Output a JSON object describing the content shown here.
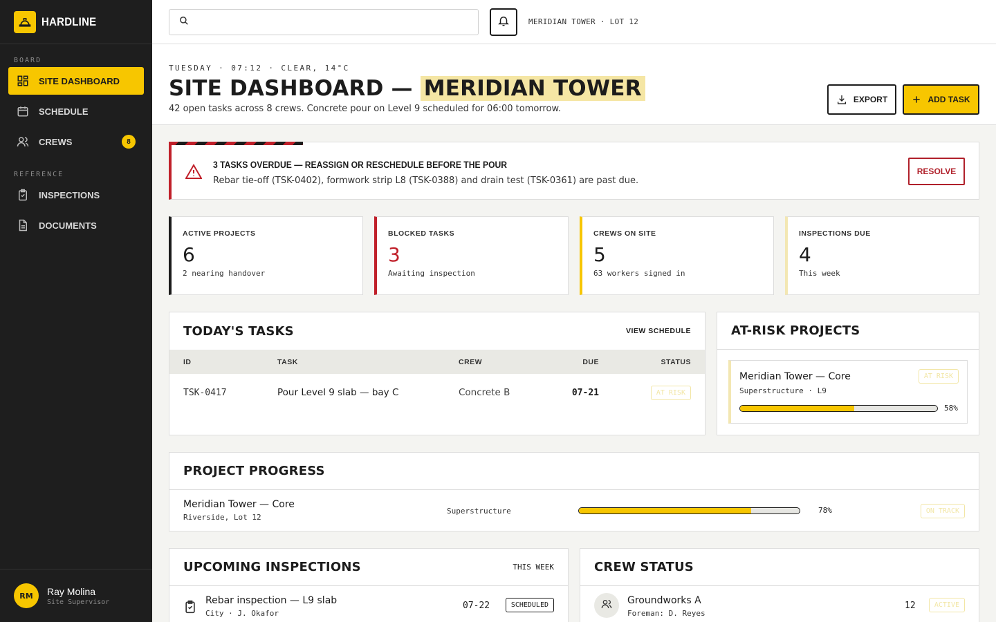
{
  "brand": {
    "name": "HARDLINE"
  },
  "sidebar": {
    "sections": [
      {
        "label": "BOARD",
        "items": [
          {
            "label": "SITE DASHBOARD",
            "icon": "grid-icon",
            "active": true
          },
          {
            "label": "SCHEDULE",
            "icon": "calendar-icon"
          },
          {
            "label": "CREWS",
            "icon": "users-icon",
            "badge": "8"
          }
        ]
      },
      {
        "label": "REFERENCE",
        "items": [
          {
            "label": "INSPECTIONS",
            "icon": "clipboard-check-icon"
          },
          {
            "label": "DOCUMENTS",
            "icon": "document-icon"
          }
        ]
      }
    ],
    "user": {
      "initials": "RM",
      "name": "Ray Molina",
      "role": "Site Supervisor"
    }
  },
  "topbar": {
    "search_placeholder": "",
    "site_label": "MERIDIAN TOWER · LOT 12"
  },
  "header": {
    "meta": "TUESDAY · 07:12 · CLEAR, 14°C",
    "title_prefix": "SITE DASHBOARD —",
    "title_highlight": "MERIDIAN TOWER",
    "subtitle": "42 open tasks across 8 crews. Concrete pour on Level 9 scheduled for 06:00 tomorrow.",
    "export_label": "EXPORT",
    "add_task_label": "ADD TASK"
  },
  "alert": {
    "title": "3 TASKS OVERDUE — REASSIGN OR RESCHEDULE BEFORE THE POUR",
    "text": "Rebar tie-off (TSK-0402), formwork strip L8 (TSK-0388) and drain test (TSK-0361) are past due.",
    "action": "RESOLVE"
  },
  "kpis": [
    {
      "label": "ACTIVE PROJECTS",
      "value": "6",
      "note": "2 nearing handover",
      "accent": "#1c1c1c",
      "value_color": "#1c1c1c"
    },
    {
      "label": "BLOCKED TASKS",
      "value": "3",
      "note": "Awaiting inspection",
      "accent": "#c0202a",
      "value_color": "#c0202a"
    },
    {
      "label": "CREWS ON SITE",
      "value": "5",
      "note": "63 workers signed in",
      "accent": "#f7c600",
      "value_color": "#1c1c1c"
    },
    {
      "label": "INSPECTIONS DUE",
      "value": "4",
      "note": "This week",
      "accent": "#f3e7b3",
      "value_color": "#1c1c1c"
    }
  ],
  "tasks": {
    "title": "TODAY'S TASKS",
    "link": "VIEW SCHEDULE",
    "columns": [
      "ID",
      "TASK",
      "CREW",
      "DUE",
      "STATUS"
    ],
    "rows": [
      {
        "id": "TSK-0417",
        "task": "Pour Level 9 slab — bay C",
        "crew": "Concrete B",
        "due": "07-21",
        "status": "AT RISK"
      }
    ]
  },
  "at_risk": {
    "title": "AT-RISK PROJECTS",
    "items": [
      {
        "name": "Meridian Tower — Core",
        "status": "AT RISK",
        "meta": "Superstructure · L9",
        "progress": 58,
        "progress_label": "58%"
      }
    ]
  },
  "progress": {
    "title": "PROJECT PROGRESS",
    "rows": [
      {
        "name": "Meridian Tower — Core",
        "location": "Riverside, Lot 12",
        "phase": "Superstructure",
        "progress": 78,
        "progress_label": "78%",
        "status": "ON TRACK"
      }
    ]
  },
  "inspections": {
    "title": "UPCOMING INSPECTIONS",
    "link": "THIS WEEK",
    "rows": [
      {
        "name": "Rebar inspection — L9 slab",
        "meta": "City · J. Okafor",
        "date": "07-22",
        "status": "SCHEDULED"
      }
    ]
  },
  "crew_status": {
    "title": "CREW STATUS",
    "rows": [
      {
        "name": "Groundworks A",
        "foreman": "Foreman: D. Reyes",
        "count": "12",
        "status": "ACTIVE"
      }
    ]
  },
  "colors": {
    "accent": "#f7c600",
    "danger": "#c0202a",
    "sidebar": "#1e1e1e"
  }
}
